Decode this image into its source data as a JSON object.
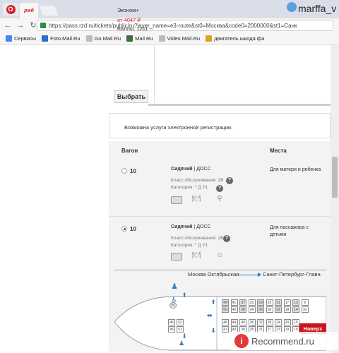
{
  "browser": {
    "user": "marffa_v",
    "url": "https://pass.rzd.ru/tickets/public/ru?layer_name=e3-route&st0=Москва&code0=2000000&st1=Санк",
    "tab_logo": "ржд",
    "bookmarks": [
      {
        "label": "Сервисы",
        "icon": "apps-icon",
        "color": "#4285f4"
      },
      {
        "label": "Foto.Mail.Ru",
        "icon": "photo-icon",
        "color": "#2f6fc8"
      },
      {
        "label": "Go.Mail.Ru",
        "icon": "page-icon",
        "color": "#bbbbbb"
      },
      {
        "label": "Mail.Ru",
        "icon": "mail-icon",
        "color": "#3a6e3a"
      },
      {
        "label": "Video.Mail.Ru",
        "icon": "page-icon",
        "color": "#bbbbbb"
      },
      {
        "label": "двигатель шкода фа",
        "icon": "search-icon",
        "color": "#e0a020"
      }
    ]
  },
  "fare": {
    "class_name": "Эконом+",
    "price": "от 4047 ₽",
    "points": "Баллы: 1211",
    "select_label": "Выбрать"
  },
  "registration_note": "Возможна услуга электронной регистрации.",
  "table": {
    "col_car": "Вагон",
    "col_places": "Места",
    "rows": [
      {
        "car": "10",
        "selected": false,
        "seat_type": "Сидячий",
        "seat_code": "ДОСС",
        "service_class": "Класс обслуживания: 2В",
        "category": "Категория: * Д У1",
        "places": "Для матери и ребенка"
      },
      {
        "car": "10",
        "selected": true,
        "seat_type": "Сидячий",
        "seat_code": "ДОСС",
        "service_class": "Класс обслуживания: 2В",
        "category": "Категория: * Д У1",
        "places": "Для пассажира с детьми"
      }
    ]
  },
  "route": {
    "from": "Москва Октябрьская",
    "to": "Санкт-Петербург-Главн."
  },
  "seat_map": {
    "top_row": [
      "49",
      "41",
      "37",
      "33",
      "29",
      "25",
      "21",
      "17",
      "13",
      "9"
    ],
    "second_row": [
      "50",
      "42",
      "38",
      "34",
      "30",
      "26",
      "22",
      "18",
      "14",
      "10"
    ],
    "third_row": [
      "48",
      "44",
      "40",
      "36",
      "32",
      "28",
      "24",
      "20",
      "16"
    ],
    "bottom_row": [
      "47",
      "43",
      "39",
      "35",
      "31",
      "27",
      "23",
      "19",
      "15"
    ],
    "left_block_top": [
      "46",
      "52"
    ],
    "left_block_bottom": [
      "45",
      "51"
    ]
  },
  "back_label": "Наверх",
  "watermark": "Recommend.ru"
}
